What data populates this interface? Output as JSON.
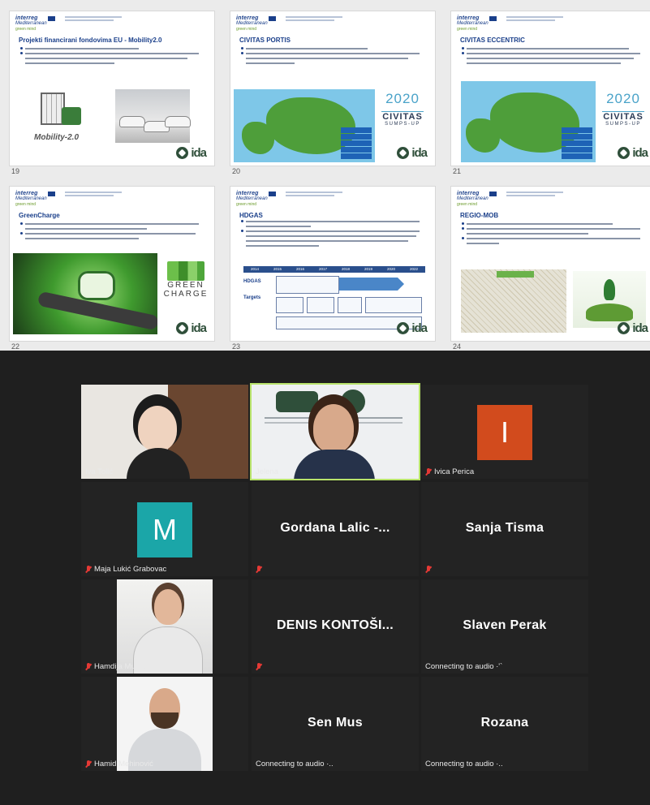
{
  "slides": [
    {
      "num": "19",
      "title": "Projekti financirani fondovima EU - Mobility2.0",
      "image_text": "Mobility-2.0"
    },
    {
      "num": "20",
      "title": "CIVITAS PORTIS",
      "logo_year": "2020",
      "logo_name": "CIVITAS",
      "logo_sub": "SUMPS-UP"
    },
    {
      "num": "21",
      "title": "CIVITAS ECCENTRIC",
      "logo_year": "2020",
      "logo_name": "CIVITAS",
      "logo_sub": "SUMPS-UP"
    },
    {
      "num": "22",
      "title": "GreenCharge",
      "logo_top": "GREEN",
      "logo_bottom": "CHARGE"
    },
    {
      "num": "23",
      "title": "HDGAS",
      "row1": "HDGAS",
      "row2": "Targets",
      "years": [
        "2014",
        "2015",
        "2016",
        "2017",
        "2018",
        "2019",
        "2020",
        "2022"
      ]
    },
    {
      "num": "24",
      "title": "REGIO-MOB"
    }
  ],
  "slide_logo": {
    "brand": "interreg",
    "program": "Mediterranean",
    "project": "green mind",
    "partner_logo": "ida"
  },
  "participants": [
    {
      "id": "iva",
      "name": "Iva Tolić",
      "muted": false,
      "video": true
    },
    {
      "id": "jelena",
      "name": "Jelena",
      "muted": false,
      "video": true,
      "active_speaker": true
    },
    {
      "id": "ivica",
      "name": "Ivica Perica",
      "muted": true,
      "video": false,
      "avatar_letter": "I",
      "avatar_color": "#d24b1d"
    },
    {
      "id": "maja",
      "name": "Maja Lukić Grabovac",
      "muted": true,
      "video": false,
      "avatar_letter": "M",
      "avatar_color": "#1ba6a8"
    },
    {
      "id": "gordana",
      "display": "Gordana  Lalic  -...",
      "muted": true,
      "video": false
    },
    {
      "id": "sanja",
      "display": "Sanja Tisma",
      "muted": true,
      "video": false
    },
    {
      "id": "hamdija",
      "name": "Hamdija Mujezin",
      "muted": true,
      "video": true
    },
    {
      "id": "denis",
      "display": "DENIS  KONTOŠI...",
      "muted": true,
      "video": false
    },
    {
      "id": "slaven",
      "display": "Slaven Perak",
      "status": "Connecting to audio ·'`",
      "video": false
    },
    {
      "id": "hamid",
      "name": "Hamid Mehinović",
      "muted": true,
      "video": true
    },
    {
      "id": "sen",
      "display": "Sen Mus",
      "status": "Connecting to audio ·..",
      "video": false
    },
    {
      "id": "rozana",
      "display": "Rozana",
      "status": "Connecting to audio ·..",
      "video": false
    }
  ],
  "colors": {
    "meeting_bg": "#1f1f1f",
    "tile_bg": "#232323",
    "active_border": "#b8e36b",
    "muted_icon": "#e53935",
    "slide_title": "#1a3f8a"
  }
}
